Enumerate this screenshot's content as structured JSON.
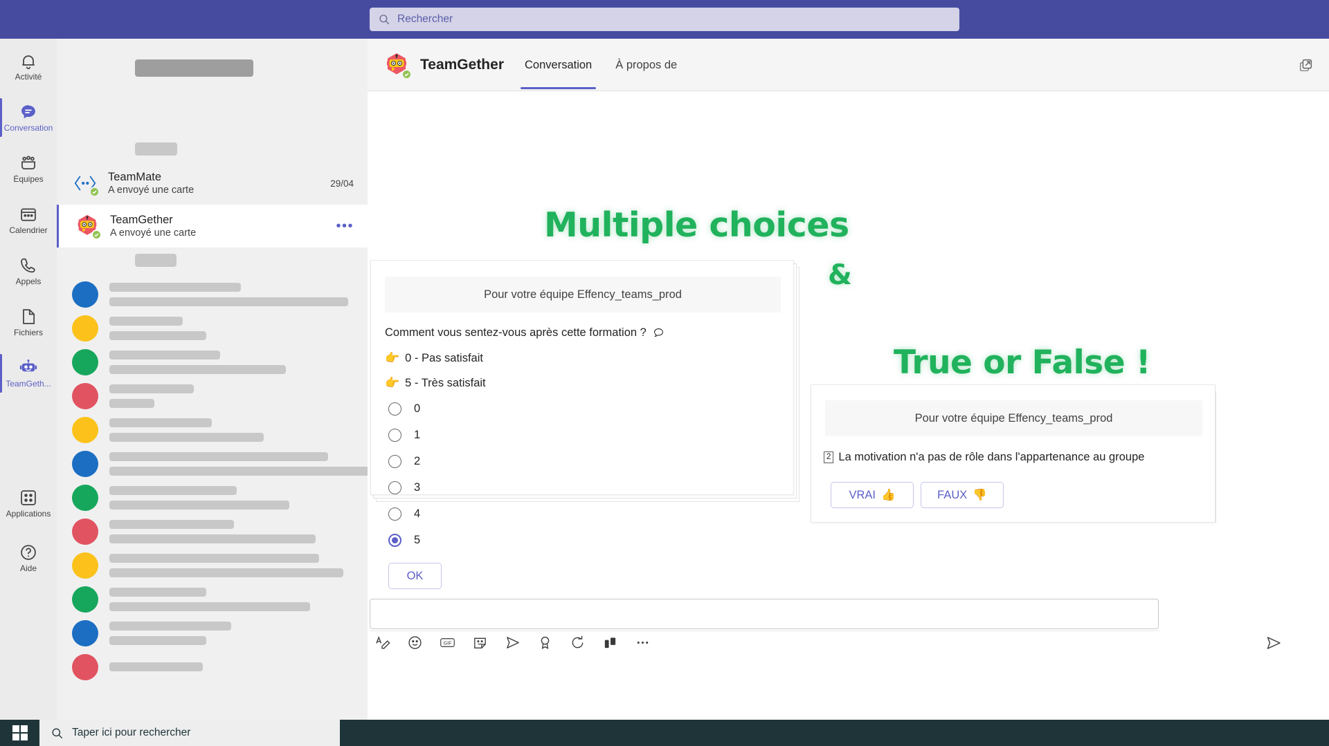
{
  "search": {
    "placeholder": "Rechercher",
    "icon": "search-icon"
  },
  "rail": {
    "items": [
      {
        "label": "Activité",
        "icon": "bell-icon",
        "active": false
      },
      {
        "label": "Conversation",
        "icon": "chat-icon",
        "active": true
      },
      {
        "label": "Équipes",
        "icon": "teams-icon",
        "active": false
      },
      {
        "label": "Calendrier",
        "icon": "calendar-icon",
        "active": false
      },
      {
        "label": "Appels",
        "icon": "phone-icon",
        "active": false
      },
      {
        "label": "Fichiers",
        "icon": "file-icon",
        "active": false
      },
      {
        "label": "TeamGeth...",
        "icon": "robot-icon",
        "active": true
      },
      {
        "label": "Applications",
        "icon": "apps-icon",
        "active": false
      },
      {
        "label": "Aide",
        "icon": "help-icon",
        "active": false
      }
    ]
  },
  "chatlist": {
    "chats": [
      {
        "name": "TeamMate",
        "subtitle": "A envoyé une carte",
        "time": "29/04",
        "avatar": "teammate-avatar",
        "selected": false
      },
      {
        "name": "TeamGether",
        "subtitle": "A envoyé une carte",
        "time": "",
        "avatar": "teamgether-avatar",
        "selected": true,
        "more": "•••"
      }
    ],
    "skeleton_avatar_colors": [
      "#1b6ec2",
      "#fcc21b",
      "#16a75c",
      "#e15361",
      "#fcc21b",
      "#1b6ec2",
      "#16a75c",
      "#e15361",
      "#fcc21b",
      "#16a75c",
      "#1b6ec2",
      "#e15361"
    ]
  },
  "header": {
    "app_name": "TeamGether",
    "logo": "robot-avatar",
    "tabs": [
      {
        "label": "Conversation",
        "active": true
      },
      {
        "label": "À propos de",
        "active": false
      }
    ],
    "popout_icon": "popout-icon"
  },
  "canvas": {
    "titles": {
      "multiple": "Multiple choices",
      "amp": "&",
      "truefalse": "True or False !"
    },
    "accent_green": "#20b25c",
    "accent_purple": "#5b5fc7"
  },
  "poll_card": {
    "banner": "Pour votre équipe Effency_teams_prod",
    "question": "Comment vous sentez-vous après cette formation ?",
    "question_icon": "speech-bubble-icon",
    "hints": [
      {
        "icon": "pointing-hand-icon",
        "text": "0 - Pas satisfait"
      },
      {
        "icon": "pointing-hand-icon",
        "text": "5 - Très satisfait"
      }
    ],
    "options": [
      {
        "label": "0",
        "selected": false
      },
      {
        "label": "1",
        "selected": false
      },
      {
        "label": "2",
        "selected": false
      },
      {
        "label": "3",
        "selected": false
      },
      {
        "label": "4",
        "selected": false
      },
      {
        "label": "5",
        "selected": true
      }
    ],
    "submit_label": "OK"
  },
  "tf_card": {
    "banner": "Pour votre équipe Effency_teams_prod",
    "question_number": "2",
    "question": "La motivation n'a pas de rôle dans l'appartenance au groupe",
    "buttons": [
      {
        "label": "VRAI",
        "emoji": "👍",
        "icon": "thumbs-up-icon"
      },
      {
        "label": "FAUX",
        "emoji": "👎",
        "icon": "thumbs-down-icon"
      }
    ]
  },
  "composer": {
    "value": "",
    "tools": [
      "format-icon",
      "emoji-icon",
      "gif-icon",
      "sticker-icon",
      "send-now-icon",
      "praise-icon",
      "loop-icon",
      "poll-icon",
      "more-icon"
    ],
    "send_icon": "send-icon"
  },
  "taskbar": {
    "start_icon": "windows-icon",
    "search_placeholder": "Taper ici pour rechercher",
    "search_icon": "search-icon"
  }
}
